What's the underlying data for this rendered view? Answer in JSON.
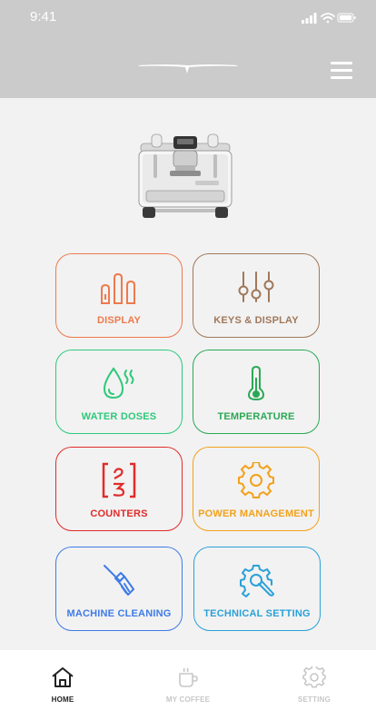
{
  "status_bar": {
    "time": "9:41"
  },
  "colors": {
    "display": "#ee7a4d",
    "keys": "#a0785a",
    "water": "#2ec97a",
    "temperature": "#2aa955",
    "counters": "#e02b2b",
    "power": "#f3a11a",
    "cleaning": "#3f7be6",
    "technical": "#2aa1d8",
    "tab_active": "#222222",
    "tab_inactive": "#c7c7c7"
  },
  "tiles": {
    "display": {
      "label": "DISPLAY",
      "icon": "bars-icon"
    },
    "keys_display": {
      "label": "KEYS & DISPLAY",
      "icon": "sliders-icon"
    },
    "water_doses": {
      "label": "WATER DOSES",
      "icon": "water-drop-icon"
    },
    "temperature": {
      "label": "TEMPERATURE",
      "icon": "thermometer-icon"
    },
    "counters": {
      "label": "COUNTERS",
      "icon": "counter-icon"
    },
    "power_management": {
      "label": "POWER MANAGEMENT",
      "icon": "gear-icon"
    },
    "machine_cleaning": {
      "label": "MACHINE CLEANING",
      "icon": "broom-icon"
    },
    "technical_setting": {
      "label": "TECHNICAL SETTING",
      "icon": "wrench-gear-icon"
    }
  },
  "tabbar": {
    "home": "HOME",
    "my_coffee": "MY COFFEE",
    "setting": "SETTING"
  }
}
